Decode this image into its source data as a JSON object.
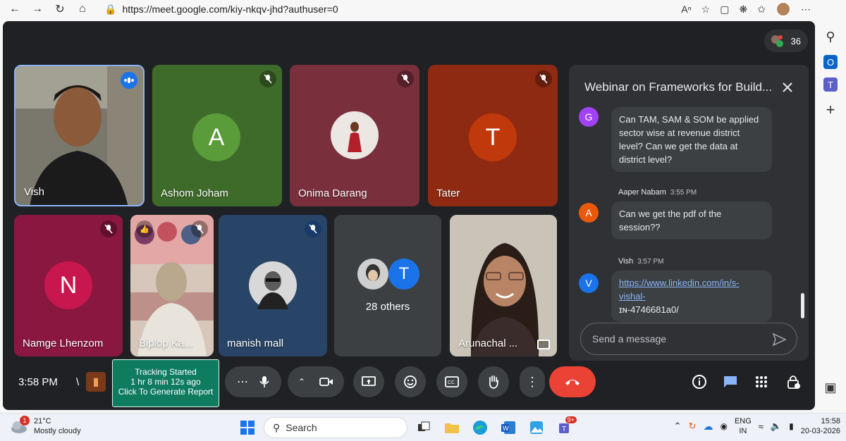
{
  "browser": {
    "url": "https://meet.google.com/kiy-nkqv-jhd?authuser=0"
  },
  "meet": {
    "participant_count": "36",
    "tiles": [
      {
        "name": "Vish",
        "kind": "video"
      },
      {
        "name": "Ashom Joham",
        "initial": "A",
        "bg": "#3f6b2a",
        "avatar_bg": "#5a9b3a"
      },
      {
        "name": "Onima Darang",
        "kind": "photo",
        "bg": "#7a2f3d"
      },
      {
        "name": "Tater",
        "initial": "T",
        "bg": "#8f2a12",
        "avatar_bg": "#c0390d"
      },
      {
        "name": "Namge Lhenzom",
        "initial": "N",
        "bg": "#8a1740",
        "avatar_bg": "#c8174e"
      },
      {
        "name": "Biplop Ka...",
        "kind": "video"
      },
      {
        "name": "manish mall",
        "kind": "photo",
        "bg": "#284466"
      },
      {
        "others": "28 others",
        "initial": "T"
      },
      {
        "name": "Arunachal ...",
        "kind": "video"
      }
    ],
    "chat": {
      "title": "Webinar on Frameworks for Build...",
      "messages": [
        {
          "initial": "G",
          "color": "#a142f4",
          "text": "Can TAM, SAM & SOM be applied sector wise at revenue district level? Can we get the data at district level?"
        },
        {
          "sender": "Aaper Nabam",
          "time": "3:55 PM",
          "initial": "A",
          "color": "#e8590c",
          "text": "Can we get the pdf of the session??"
        },
        {
          "sender": "Vish",
          "time": "3:57 PM",
          "initial": "V",
          "color": "#1a73e8",
          "link": "https://www.linkedin.com/in/s-vishal-",
          "link_rest": "ɪɴ-4746681a0/"
        }
      ],
      "input_placeholder": "Send a message"
    },
    "controls": {
      "time": "3:58 PM",
      "divider": "\\",
      "tracking_line1": "Tracking Started",
      "tracking_line2": "1 hr 8 min 12s ago",
      "tracking_line3": "Click To Generate Report"
    }
  },
  "taskbar": {
    "temperature": "21°C",
    "weather": "Mostly cloudy",
    "weather_badge": "1",
    "search_label": "Search",
    "teams_badge": "9+",
    "lang_line1": "ENG",
    "lang_line2": "IN",
    "time": "15:58",
    "date": "20-03-2026"
  }
}
